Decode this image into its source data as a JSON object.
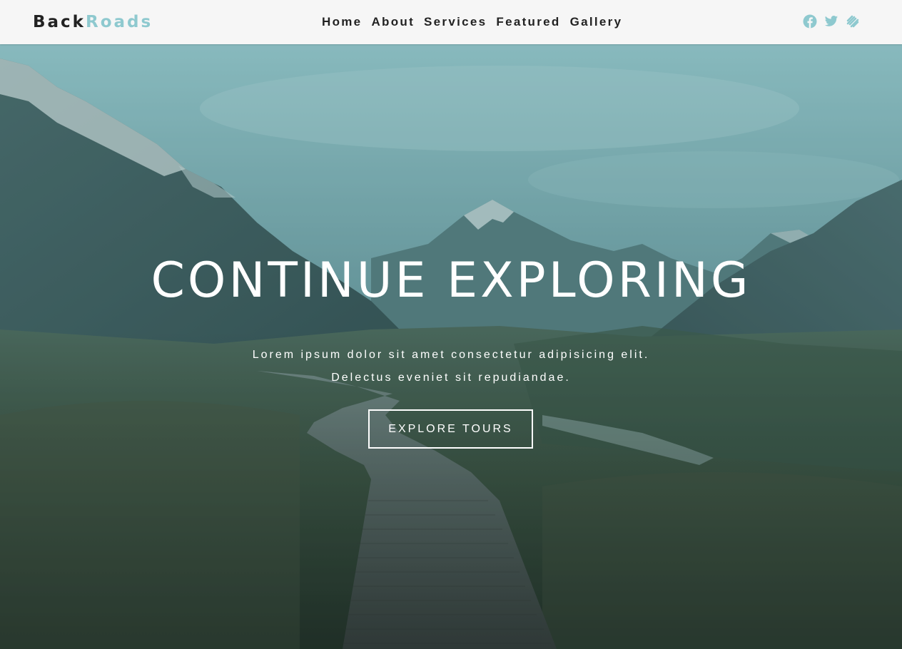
{
  "brand": {
    "part1": "Back",
    "part2": "Roads"
  },
  "nav": {
    "links": [
      {
        "label": "Home"
      },
      {
        "label": "About"
      },
      {
        "label": "Services"
      },
      {
        "label": "Featured"
      },
      {
        "label": "Gallery"
      }
    ]
  },
  "social": {
    "icons": [
      "facebook-icon",
      "twitter-icon",
      "squarespace-icon"
    ],
    "color": "#8ec9cf"
  },
  "hero": {
    "title": "CONTINUE EXPLORING",
    "text_line1": "Lorem ipsum dolor sit amet consectetur adipisicing elit.",
    "text_line2": "Delectus eveniet sit repudiandae.",
    "button_label": "EXPLORE TOURS"
  },
  "colors": {
    "accent": "#8ec9cf",
    "navbar_bg": "#f6f6f6",
    "text_dark": "#222222"
  }
}
